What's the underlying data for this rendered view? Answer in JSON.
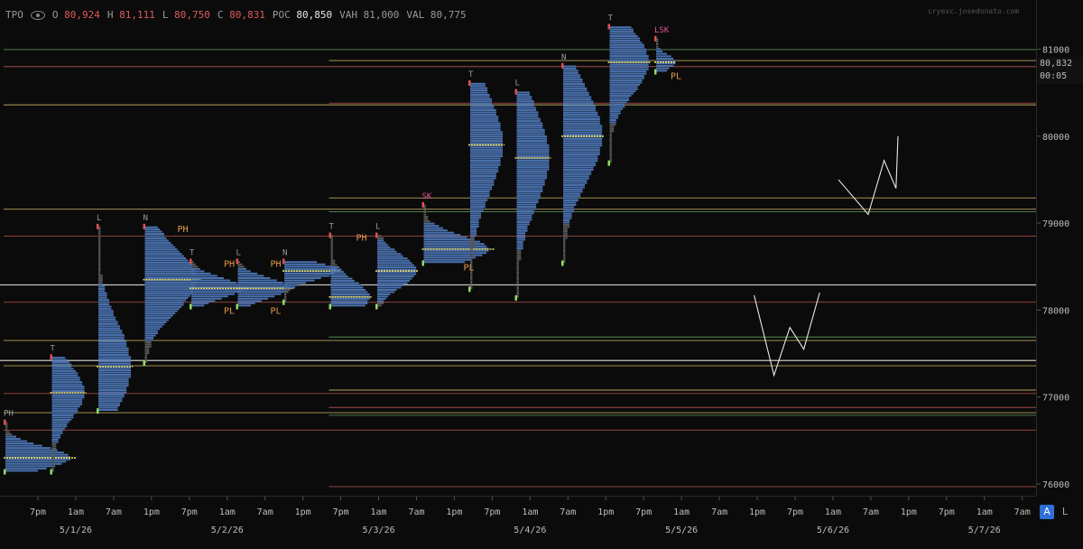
{
  "legend": {
    "study": "TPO",
    "open_label": "O",
    "open": "80,924",
    "high_label": "H",
    "high": "81,111",
    "low_label": "L",
    "low": "80,750",
    "close_label": "C",
    "close": "80,831",
    "poc_label": "POC",
    "poc": "80,850",
    "vah_label": "VAH",
    "vah": "81,000",
    "val_label": "VAL",
    "val": "80,775"
  },
  "watermark": "cryexc.josedonato.com",
  "price_tag": {
    "price": "80,832",
    "countdown": "00:05"
  },
  "buttons": {
    "auto": "A",
    "log": "L"
  },
  "colors": {
    "background": "#0b0b0b",
    "tpo_profile": "#4a72b0",
    "tpo_tail": "#5a5a5a",
    "poc": "#f0e060",
    "level_green": "#5e9a5e",
    "level_red": "#b05050",
    "level_yellow": "#c9b464",
    "open_marker": "#8fdc63",
    "close_marker": "#e05050",
    "label_orange": "#e59a4a",
    "label_pink": "#e0569a"
  },
  "chart_data": {
    "type": "tpo-profile",
    "price_axis": {
      "ticks": [
        76000,
        77000,
        78000,
        79000,
        80000,
        81000
      ],
      "ylim": [
        75900,
        81350
      ]
    },
    "time_axis": {
      "tick_labels": [
        "7pm",
        "1am",
        "7am",
        "1pm",
        "7pm",
        "1am",
        "7am",
        "1pm",
        "7pm",
        "1am",
        "7am",
        "1pm",
        "7pm",
        "1am",
        "7am",
        "1pm",
        "7pm",
        "1am",
        "7am",
        "1pm",
        "7pm",
        "1am",
        "7am",
        "1pm",
        "7pm",
        "1am",
        "7am"
      ],
      "date_labels": [
        "5/1/26",
        "5/2/26",
        "5/3/26",
        "5/4/26",
        "5/5/26",
        "5/6/26",
        "5/7/26"
      ]
    },
    "sessions": [
      {
        "low": 76150,
        "high": 76700,
        "poc": 76300,
        "width": 5,
        "label": "PH",
        "label_pos": "top"
      },
      {
        "low": 76150,
        "high": 77450,
        "poc": 77050,
        "width": 2.5,
        "label": "T",
        "label_pos": "top"
      },
      {
        "low": 76850,
        "high": 78950,
        "poc": 77350,
        "width": 2.5,
        "label": "L",
        "label_pos": "top"
      },
      {
        "low": 77400,
        "high": 78950,
        "poc": 78350,
        "width": 4,
        "label": "N",
        "label_pos": "top"
      },
      {
        "low": 78050,
        "high": 78550,
        "poc": 78250,
        "width": 4,
        "label": "T",
        "label_pos": "top"
      },
      {
        "low": 78050,
        "high": 78550,
        "poc": 78250,
        "width": 4,
        "label": "L",
        "label_pos": "top"
      },
      {
        "low": 78100,
        "high": 78550,
        "poc": 78450,
        "width": 4,
        "label": "N",
        "label_pos": "top"
      },
      {
        "low": 78050,
        "high": 78850,
        "poc": 78150,
        "width": 3,
        "label": "T",
        "label_pos": "top"
      },
      {
        "low": 78050,
        "high": 78850,
        "poc": 78450,
        "width": 3,
        "label": "L",
        "label_pos": "top"
      },
      {
        "low": 78550,
        "high": 79200,
        "poc": 78700,
        "width": 5,
        "label": "SK",
        "label_pos": "top"
      },
      {
        "low": 78250,
        "high": 80600,
        "poc": 79900,
        "width": 2.5,
        "label": "T",
        "label_pos": "top"
      },
      {
        "low": 78150,
        "high": 80500,
        "poc": 79750,
        "width": 2.5,
        "label": "L",
        "label_pos": "top"
      },
      {
        "low": 78550,
        "high": 80800,
        "poc": 80000,
        "width": 3,
        "label": "N",
        "label_pos": "top"
      },
      {
        "low": 79700,
        "high": 81250,
        "poc": 80850,
        "width": 3,
        "label": "T",
        "label_pos": "top"
      },
      {
        "low": 80750,
        "high": 81111,
        "poc": 80850,
        "width": 1.5,
        "label": "LSK",
        "label_pos": "top"
      }
    ],
    "session_side_labels": [
      {
        "session": 3,
        "text": "PH"
      },
      {
        "session": 4,
        "text": "PH"
      },
      {
        "session": 4,
        "text": "PL"
      },
      {
        "session": 5,
        "text": "PH"
      },
      {
        "session": 5,
        "text": "PL"
      },
      {
        "session": 7,
        "text": "PH"
      },
      {
        "session": 9,
        "text": "PL"
      },
      {
        "session": 14,
        "text": "PL"
      }
    ],
    "levels": [
      {
        "price": 80995,
        "color": "green"
      },
      {
        "price": 80870,
        "color": "yellow"
      },
      {
        "price": 80800,
        "color": "red"
      },
      {
        "price": 80380,
        "color": "red"
      },
      {
        "price": 80360,
        "color": "yellow"
      },
      {
        "price": 79290,
        "color": "yellow"
      },
      {
        "price": 79160,
        "color": "yellow"
      },
      {
        "price": 79130,
        "color": "green"
      },
      {
        "price": 78850,
        "color": "red"
      },
      {
        "price": 78290,
        "color": "white"
      },
      {
        "price": 78090,
        "color": "red"
      },
      {
        "price": 77690,
        "color": "green"
      },
      {
        "price": 77650,
        "color": "yellow"
      },
      {
        "price": 77420,
        "color": "white"
      },
      {
        "price": 77360,
        "color": "yellow"
      },
      {
        "price": 77080,
        "color": "yellow"
      },
      {
        "price": 77040,
        "color": "red"
      },
      {
        "price": 76880,
        "color": "red"
      },
      {
        "price": 76820,
        "color": "yellow"
      },
      {
        "price": 76790,
        "color": "green"
      },
      {
        "price": 76620,
        "color": "red"
      },
      {
        "price": 75970,
        "color": "red"
      }
    ],
    "drawings": [
      {
        "shape": "W",
        "points": [
          [
            0.8,
            78170
          ],
          [
            1.8,
            77250
          ],
          [
            2.6,
            77800
          ],
          [
            3.3,
            77550
          ],
          [
            4.1,
            78200
          ]
        ]
      },
      {
        "shape": "N",
        "points": [
          [
            0.5,
            79500
          ],
          [
            2.0,
            79100
          ],
          [
            2.8,
            79720
          ],
          [
            3.4,
            79400
          ],
          [
            3.5,
            80000
          ]
        ]
      }
    ]
  }
}
